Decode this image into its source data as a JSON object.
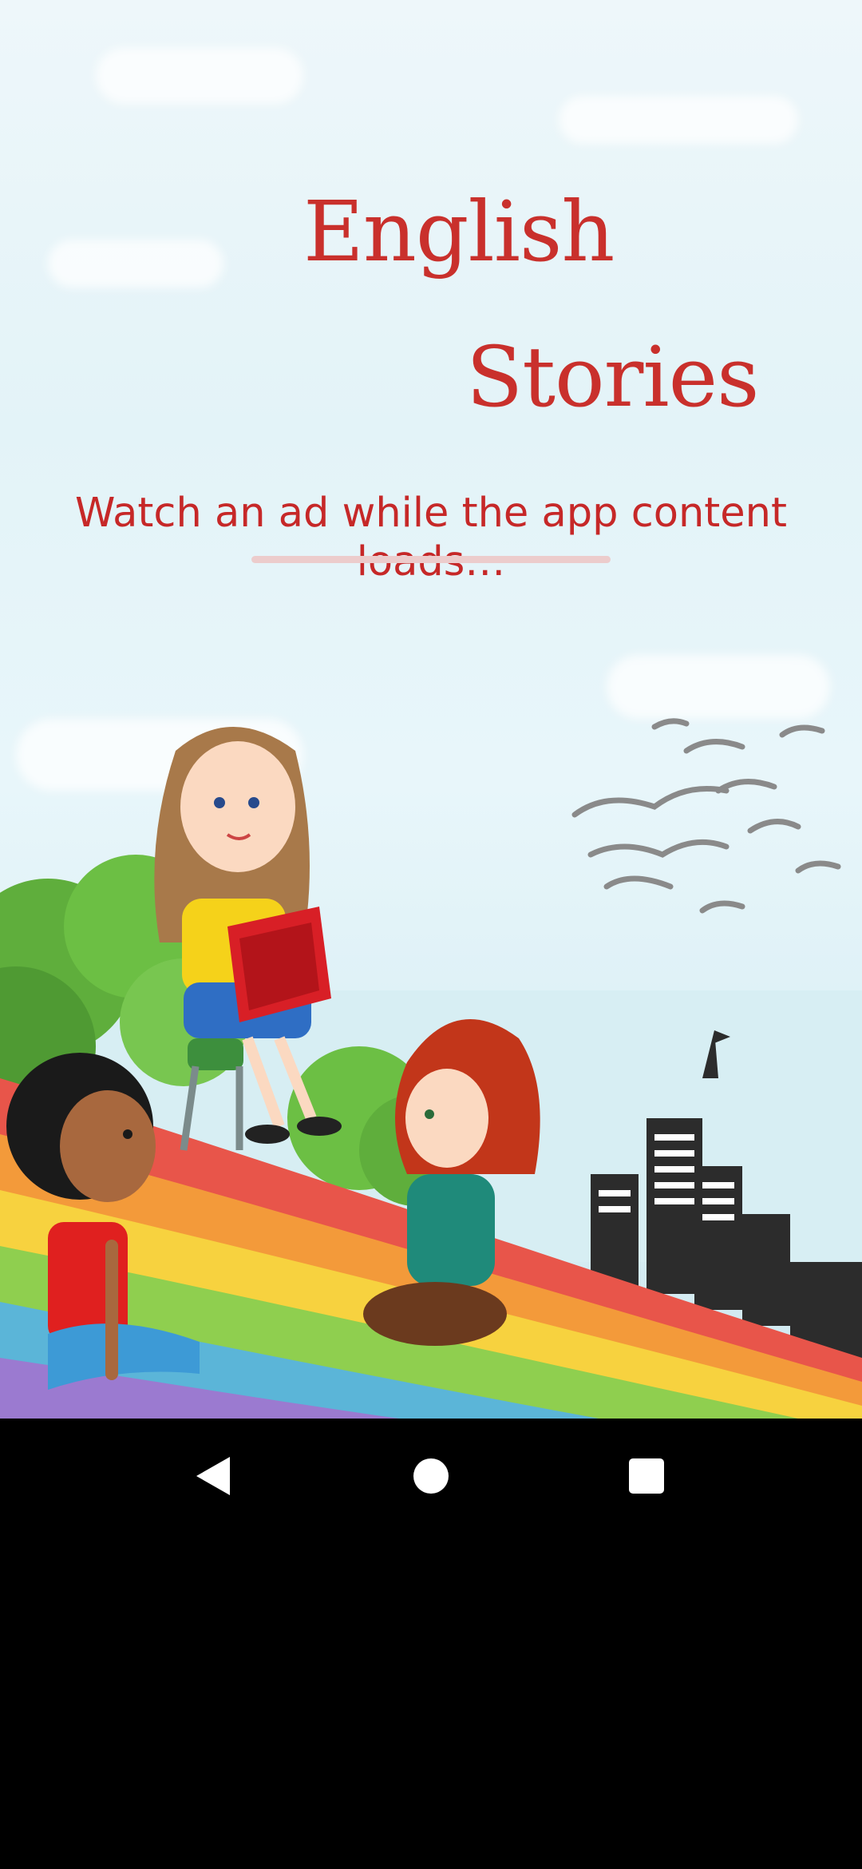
{
  "app": {
    "title_line1": "English",
    "title_line2": "Stories",
    "loading_message": "Watch an ad while the app content loads…",
    "loading_progress": 0.0,
    "accent_color": "#c62828"
  },
  "illustration": {
    "description_icon": "children-reading-illustration-icon"
  },
  "navbar": {
    "back_icon": "back-triangle-icon",
    "home_icon": "home-circle-icon",
    "recents_icon": "recents-square-icon"
  }
}
